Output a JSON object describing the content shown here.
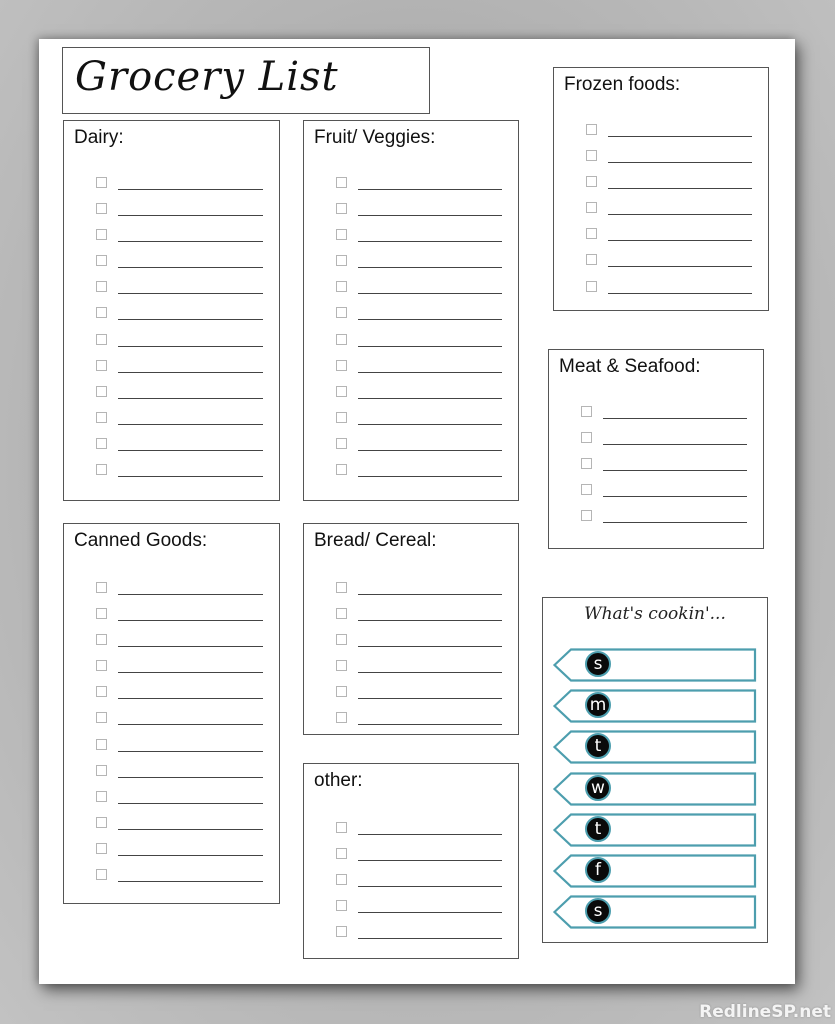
{
  "title": "Grocery List",
  "watermark": "RedlineSP.net",
  "accent_color": "#4d9eae",
  "sections": {
    "dairy": {
      "label": "Dairy:",
      "rows": 12
    },
    "fruit_veggies": {
      "label": "Fruit/ Veggies:",
      "rows": 12
    },
    "frozen_foods": {
      "label": "Frozen foods:",
      "rows": 7
    },
    "meat_seafood": {
      "label": "Meat & Seafood:",
      "rows": 5
    },
    "canned_goods": {
      "label": "Canned Goods:",
      "rows": 12
    },
    "bread_cereal": {
      "label": "Bread/ Cereal:",
      "rows": 6
    },
    "other": {
      "label": "other:",
      "rows": 5
    }
  },
  "meal_plan": {
    "title": "What's cookin'...",
    "days": [
      "s",
      "m",
      "t",
      "w",
      "t",
      "f",
      "s"
    ]
  }
}
